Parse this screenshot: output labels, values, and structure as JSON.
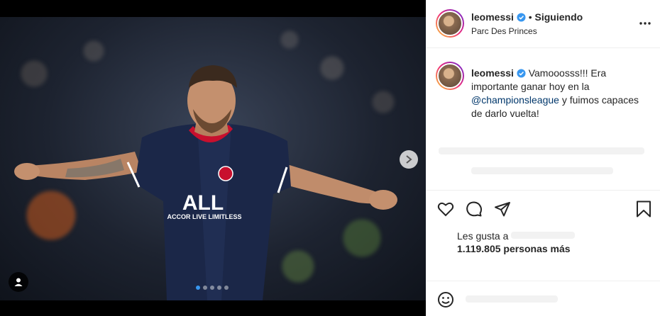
{
  "post": {
    "username": "leomessi",
    "separator": "•",
    "follow_status": "Siguiendo",
    "location": "Parc Des Princes",
    "caption_before": "Vamooosss!!! Era importante ganar hoy en la ",
    "caption_mention": "@championsleague",
    "caption_after": " y fuimos capaces de darlo vuelta!",
    "likes_label": "Les gusta a",
    "likes_count": "1.119.805 personas más",
    "jersey_text": "ALL",
    "jersey_subtext": "ACCOR LIVE LIMITLESS",
    "carousel_dots": 5,
    "carousel_active": 0
  },
  "icons": {
    "verified": "verified-badge-icon",
    "more": "more-options-icon",
    "like": "heart-icon",
    "comment": "comment-icon",
    "share": "paper-plane-icon",
    "save": "bookmark-icon",
    "emoji": "smiley-icon",
    "next": "chevron-right-icon",
    "tag": "user-tag-icon"
  },
  "colors": {
    "verified": "#3897f0",
    "mention": "#00376b",
    "text": "#262626",
    "jersey": "#1b2748"
  }
}
